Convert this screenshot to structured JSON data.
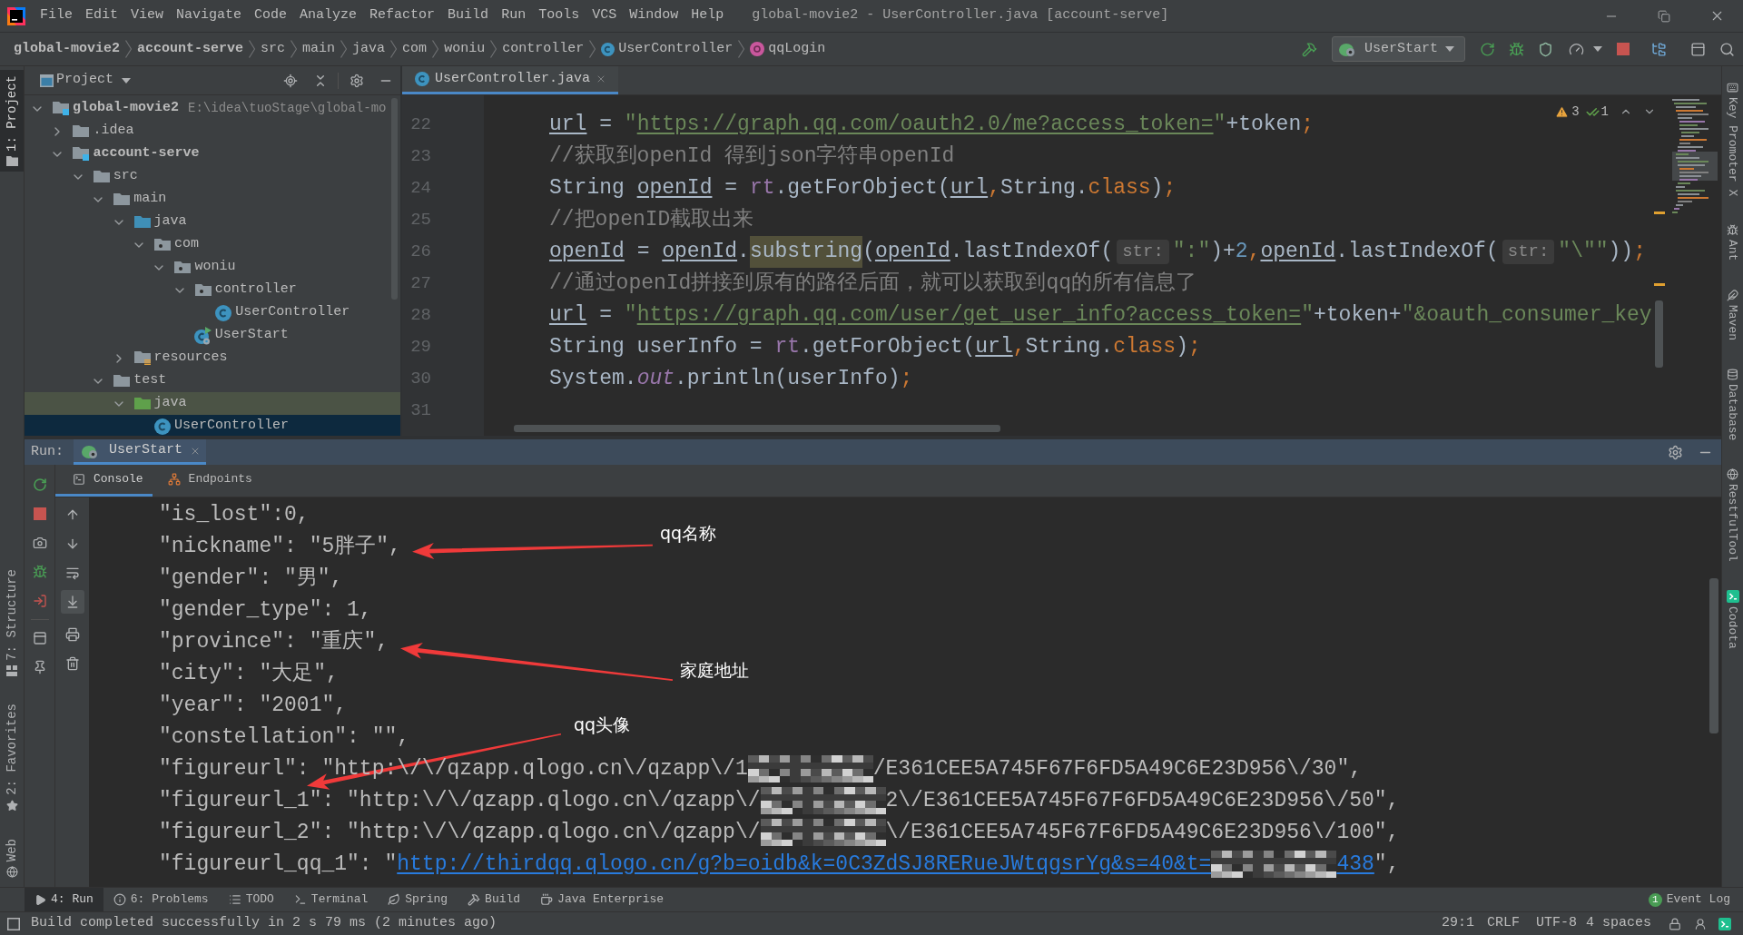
{
  "title_bar": {
    "menu": [
      "File",
      "Edit",
      "View",
      "Navigate",
      "Code",
      "Analyze",
      "Refactor",
      "Build",
      "Run",
      "Tools",
      "VCS",
      "Window",
      "Help"
    ],
    "title": "global-movie2 - UserController.java [account-serve]"
  },
  "navigation_bar": {
    "breadcrumbs": [
      {
        "label": "global-movie2",
        "kind": "module"
      },
      {
        "label": "account-serve",
        "kind": "module"
      },
      {
        "label": "src",
        "kind": "folder"
      },
      {
        "label": "main",
        "kind": "folder"
      },
      {
        "label": "java",
        "kind": "folder"
      },
      {
        "label": "com",
        "kind": "folder"
      },
      {
        "label": "woniu",
        "kind": "folder"
      },
      {
        "label": "controller",
        "kind": "folder"
      },
      {
        "label": "UserController",
        "kind": "class"
      },
      {
        "label": "qqLogin",
        "kind": "method"
      }
    ],
    "run_configuration": "UserStart"
  },
  "left_stripe": [
    {
      "label": "1: Project",
      "selected": true
    },
    {
      "label": "7: Structure",
      "selected": false
    },
    {
      "label": "2: Favorites",
      "selected": false
    },
    {
      "label": "Web",
      "selected": false
    }
  ],
  "project_panel": {
    "title": "Project",
    "tree": [
      {
        "label": "global-movie2",
        "kind": "module",
        "detail": "E:\\idea\\tuoStage\\global-mo",
        "expanded": true,
        "selected": false,
        "highlighted": false,
        "children": [
          {
            "label": ".idea",
            "kind": "folder",
            "expanded": false,
            "selected": false,
            "highlighted": false
          },
          {
            "label": "account-serve",
            "kind": "module",
            "expanded": true,
            "selected": false,
            "highlighted": false,
            "children": [
              {
                "label": "src",
                "kind": "folder",
                "expanded": true,
                "selected": false,
                "highlighted": false,
                "children": [
                  {
                    "label": "main",
                    "kind": "folder",
                    "expanded": true,
                    "selected": false,
                    "highlighted": false,
                    "children": [
                      {
                        "label": "java",
                        "kind": "source-root",
                        "expanded": true,
                        "selected": false,
                        "highlighted": false,
                        "children": [
                          {
                            "label": "com",
                            "kind": "package",
                            "expanded": true,
                            "selected": false,
                            "highlighted": false,
                            "children": [
                              {
                                "label": "woniu",
                                "kind": "package",
                                "expanded": true,
                                "selected": false,
                                "highlighted": false,
                                "children": [
                                  {
                                    "label": "controller",
                                    "kind": "package",
                                    "expanded": true,
                                    "selected": false,
                                    "highlighted": false,
                                    "children": [
                                      {
                                        "label": "UserController",
                                        "kind": "class",
                                        "selected": false,
                                        "highlighted": false
                                      }
                                    ]
                                  },
                                  {
                                    "label": "UserStart",
                                    "kind": "app-class",
                                    "selected": false,
                                    "highlighted": false
                                  }
                                ]
                              }
                            ]
                          }
                        ]
                      },
                      {
                        "label": "resources",
                        "kind": "resources-root",
                        "expanded": false,
                        "selected": false,
                        "highlighted": false
                      }
                    ]
                  },
                  {
                    "label": "test",
                    "kind": "folder",
                    "expanded": true,
                    "selected": false,
                    "highlighted": false,
                    "children": [
                      {
                        "label": "java",
                        "kind": "test-root",
                        "expanded": true,
                        "selected": false,
                        "highlighted": true,
                        "children": [
                          {
                            "label": "UserController",
                            "kind": "class",
                            "selected": true,
                            "highlighted": false
                          }
                        ]
                      }
                    ]
                  }
                ]
              }
            ]
          }
        ]
      }
    ]
  },
  "editor": {
    "tabs": [
      {
        "label": "UserController.java",
        "selected": true
      }
    ],
    "warning_count": "3",
    "check_count": "1",
    "lines": [
      {
        "number": "22",
        "segments": [
          {
            "kind": "reassigned",
            "text": "url"
          },
          {
            "kind": "plain",
            "text": " = "
          },
          {
            "kind": "string",
            "text": "\""
          },
          {
            "kind": "link",
            "text": "https://graph.qq.com/oauth2.0/me?access_token="
          },
          {
            "kind": "string",
            "text": "\""
          },
          {
            "kind": "plain",
            "text": "+token"
          },
          {
            "kind": "keyword",
            "text": ";"
          }
        ]
      },
      {
        "number": "23",
        "segments": [
          {
            "kind": "comment",
            "text": "//获取到openId 得到json字符串openId"
          }
        ]
      },
      {
        "number": "24",
        "segments": [
          {
            "kind": "plain",
            "text": "String "
          },
          {
            "kind": "reassigned",
            "text": "openId"
          },
          {
            "kind": "plain",
            "text": " = "
          },
          {
            "kind": "field",
            "text": "rt"
          },
          {
            "kind": "plain",
            "text": ".getForObject("
          },
          {
            "kind": "reassigned",
            "text": "url"
          },
          {
            "kind": "keyword",
            "text": ","
          },
          {
            "kind": "plain",
            "text": "String."
          },
          {
            "kind": "keyword",
            "text": "class"
          },
          {
            "kind": "plain",
            "text": ")"
          },
          {
            "kind": "keyword",
            "text": ";"
          }
        ]
      },
      {
        "number": "25",
        "segments": [
          {
            "kind": "comment",
            "text": "//把openID截取出来"
          }
        ]
      },
      {
        "number": "26",
        "segments": [
          {
            "kind": "reassigned",
            "text": "openId"
          },
          {
            "kind": "plain",
            "text": " = "
          },
          {
            "kind": "reassigned",
            "text": "openId"
          },
          {
            "kind": "plain",
            "text": "."
          },
          {
            "kind": "usage",
            "text": "substring"
          },
          {
            "kind": "plain",
            "text": "("
          },
          {
            "kind": "reassigned",
            "text": "openId"
          },
          {
            "kind": "plain",
            "text": ".lastIndexOf("
          },
          {
            "kind": "hint",
            "text": "str:"
          },
          {
            "kind": "string",
            "text": "\":\""
          },
          {
            "kind": "plain",
            "text": ")+"
          },
          {
            "kind": "number",
            "text": "2"
          },
          {
            "kind": "keyword",
            "text": ","
          },
          {
            "kind": "reassigned",
            "text": "openId"
          },
          {
            "kind": "plain",
            "text": ".lastIndexOf("
          },
          {
            "kind": "hint",
            "text": "str:"
          },
          {
            "kind": "string",
            "text": "\"\\\"\""
          },
          {
            "kind": "plain",
            "text": "))"
          },
          {
            "kind": "keyword",
            "text": ";"
          }
        ]
      },
      {
        "number": "27",
        "segments": [
          {
            "kind": "comment",
            "text": "//通过openId拼接到原有的路径后面，就可以获取到qq的所有信息了"
          }
        ]
      },
      {
        "number": "28",
        "segments": [
          {
            "kind": "reassigned",
            "text": "url"
          },
          {
            "kind": "plain",
            "text": " = "
          },
          {
            "kind": "string",
            "text": "\""
          },
          {
            "kind": "link",
            "text": "https://graph.qq.com/user/get_user_info?access_token="
          },
          {
            "kind": "string",
            "text": "\""
          },
          {
            "kind": "plain",
            "text": "+token+"
          },
          {
            "kind": "string",
            "text": "\"&oauth_consumer_key"
          }
        ]
      },
      {
        "number": "29",
        "segments": [
          {
            "kind": "plain",
            "text": "String userInfo = "
          },
          {
            "kind": "field",
            "text": "rt"
          },
          {
            "kind": "plain",
            "text": ".getForObject("
          },
          {
            "kind": "reassigned",
            "text": "url"
          },
          {
            "kind": "keyword",
            "text": ","
          },
          {
            "kind": "plain",
            "text": "String."
          },
          {
            "kind": "keyword",
            "text": "class"
          },
          {
            "kind": "plain",
            "text": ")"
          },
          {
            "kind": "keyword",
            "text": ";"
          }
        ]
      },
      {
        "number": "30",
        "segments": [
          {
            "kind": "plain",
            "text": "System."
          },
          {
            "kind": "static",
            "text": "out"
          },
          {
            "kind": "plain",
            "text": ".println(userInfo)"
          },
          {
            "kind": "keyword",
            "text": ";"
          }
        ]
      },
      {
        "number": "31"
      }
    ]
  },
  "run_panel": {
    "label": "Run:",
    "tabs": [
      {
        "label": "UserStart",
        "selected": true
      }
    ],
    "views": [
      {
        "label": "Console",
        "selected": true
      },
      {
        "label": "Endpoints",
        "selected": false
      }
    ],
    "console": [
      {
        "text": "\"is_lost\":0,"
      },
      {
        "text": "\"nickname\": \"5胖子\","
      },
      {
        "text": "\"gender\": \"男\","
      },
      {
        "text": "\"gender_type\": 1,"
      },
      {
        "text": "\"province\": \"重庆\","
      },
      {
        "text": "\"city\": \"大足\","
      },
      {
        "text": "\"year\": \"2001\","
      },
      {
        "text": "\"constellation\": \"\","
      },
      {
        "segments": [
          {
            "kind": "text",
            "text": "\"figureurl\": \"http:\\/\\/qzapp.qlogo.cn\\/qzapp\\/1"
          },
          {
            "kind": "blur"
          },
          {
            "kind": "text",
            "text": "/E361CEE5A745F67F6FD5A49C6E23D956\\/30\","
          }
        ]
      },
      {
        "segments": [
          {
            "kind": "text",
            "text": "\"figureurl_1\": \"http:\\/\\/qzapp.qlogo.cn\\/qzapp\\/"
          },
          {
            "kind": "blur"
          },
          {
            "kind": "text",
            "text": "2\\/E361CEE5A745F67F6FD5A49C6E23D956\\/50\","
          }
        ]
      },
      {
        "segments": [
          {
            "kind": "text",
            "text": "\"figureurl_2\": \"http:\\/\\/qzapp.qlogo.cn\\/qzapp\\/"
          },
          {
            "kind": "blur"
          },
          {
            "kind": "text",
            "text": "\\/E361CEE5A745F67F6FD5A49C6E23D956\\/100\","
          }
        ]
      },
      {
        "segments": [
          {
            "kind": "text",
            "text": "\"figureurl_qq_1\": \""
          },
          {
            "kind": "link",
            "text": "http://thirdqq.qlogo.cn/g?b=oidb&k=0C3ZdSJ8RERueJWtqgsrYg&s=40&t="
          },
          {
            "kind": "blur"
          },
          {
            "kind": "link",
            "text": "438"
          },
          {
            "kind": "text",
            "text": "\","
          }
        ]
      }
    ]
  },
  "annotations": [
    {
      "text": "qq名称"
    },
    {
      "text": "家庭地址"
    },
    {
      "text": "qq头像"
    }
  ],
  "right_stripe": [
    "Key Promoter X",
    "Ant",
    "Maven",
    "Database",
    "RestfulTool",
    "Codota"
  ],
  "bottom_tabs": [
    {
      "label": "4: Run",
      "selected": true
    },
    {
      "label": "6: Problems",
      "selected": false
    },
    {
      "label": "TODO",
      "selected": false
    },
    {
      "label": "Terminal",
      "selected": false
    },
    {
      "label": "Spring",
      "selected": false
    },
    {
      "label": "Build",
      "selected": false
    },
    {
      "label": "Java Enterprise",
      "selected": false
    }
  ],
  "event_log": {
    "label": "Event Log",
    "count": "1"
  },
  "status_bar": {
    "message": "Build completed successfully in 2 s 79 ms (2 minutes ago)",
    "caret": "29:1",
    "line_separator": "CRLF",
    "encoding": "UTF-8",
    "indent": "4 spaces"
  }
}
